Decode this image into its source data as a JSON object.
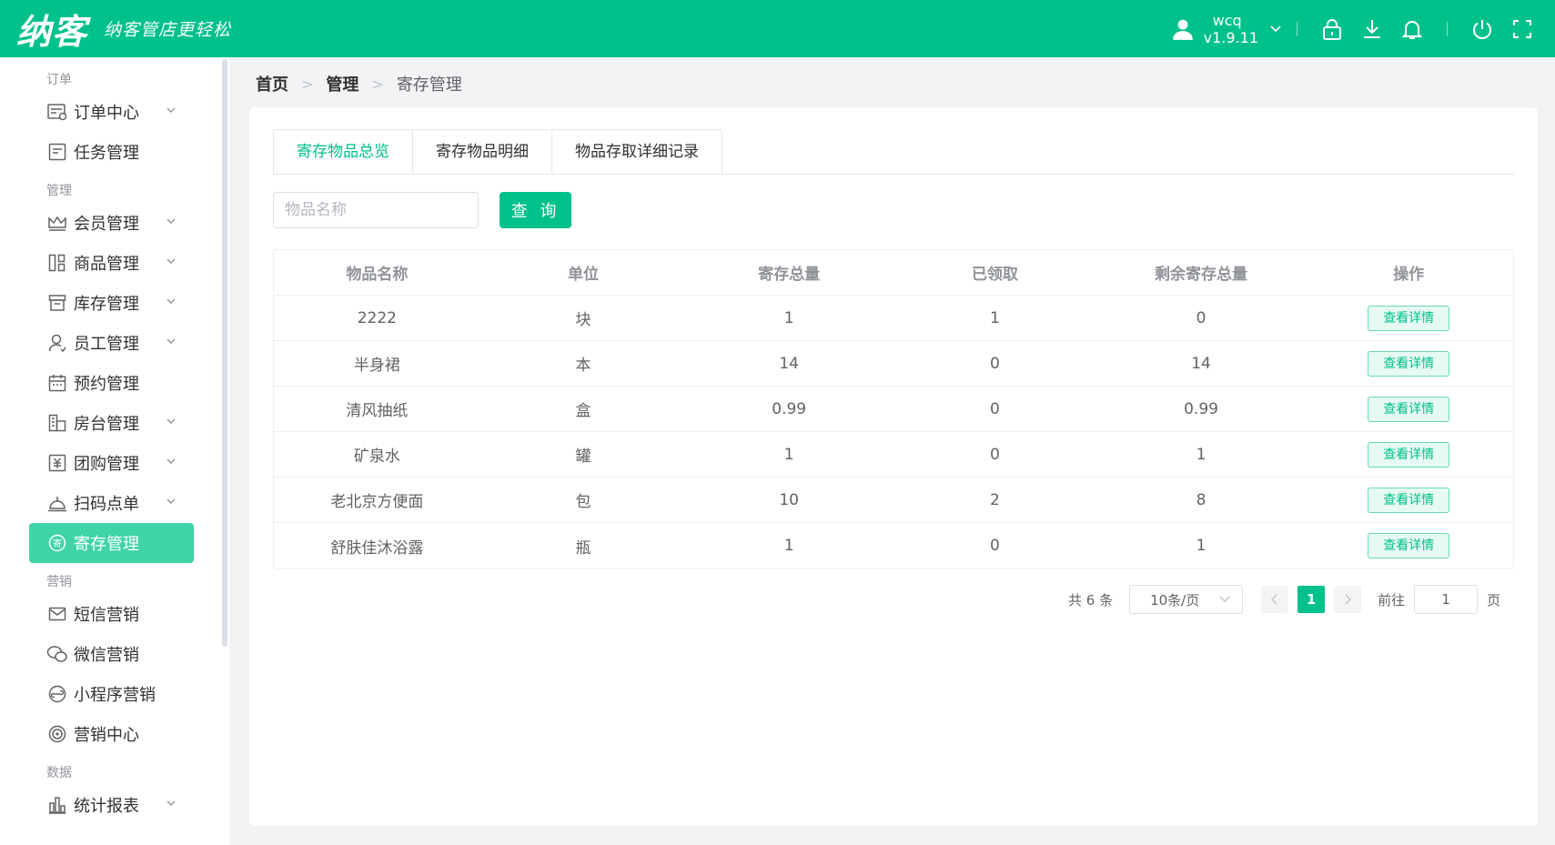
{
  "header": {
    "logo_main": "纳客",
    "slogan": "纳客管店更轻松",
    "username": "wcq",
    "version": "v1.9.11"
  },
  "sidebar": {
    "groups": [
      {
        "label": "订单",
        "items": [
          {
            "label": "订单中心",
            "icon": "order-icon",
            "has_arrow": true
          },
          {
            "label": "任务管理",
            "icon": "task-icon",
            "has_arrow": false
          }
        ]
      },
      {
        "label": "管理",
        "items": [
          {
            "label": "会员管理",
            "icon": "crown-icon",
            "has_arrow": true
          },
          {
            "label": "商品管理",
            "icon": "goods-icon",
            "has_arrow": true
          },
          {
            "label": "库存管理",
            "icon": "inventory-icon",
            "has_arrow": true
          },
          {
            "label": "员工管理",
            "icon": "staff-icon",
            "has_arrow": true
          },
          {
            "label": "预约管理",
            "icon": "calendar-icon",
            "has_arrow": false
          },
          {
            "label": "房台管理",
            "icon": "room-icon",
            "has_arrow": true
          },
          {
            "label": "团购管理",
            "icon": "groupbuy-icon",
            "has_arrow": true
          },
          {
            "label": "扫码点单",
            "icon": "bell-service-icon",
            "has_arrow": true
          },
          {
            "label": "寄存管理",
            "icon": "deposit-icon",
            "has_arrow": false,
            "active": true
          }
        ]
      },
      {
        "label": "营销",
        "items": [
          {
            "label": "短信营销",
            "icon": "mail-icon",
            "has_arrow": false
          },
          {
            "label": "微信营销",
            "icon": "wechat-icon",
            "has_arrow": false
          },
          {
            "label": "小程序营销",
            "icon": "miniprogram-icon",
            "has_arrow": false
          },
          {
            "label": "营销中心",
            "icon": "target-icon",
            "has_arrow": false
          }
        ]
      },
      {
        "label": "数据",
        "items": [
          {
            "label": "统计报表",
            "icon": "chart-icon",
            "has_arrow": true
          }
        ]
      }
    ]
  },
  "breadcrumb": {
    "home": "首页",
    "section": "管理",
    "current": "寄存管理"
  },
  "tabs": [
    {
      "label": "寄存物品总览",
      "active": true
    },
    {
      "label": "寄存物品明细",
      "active": false
    },
    {
      "label": "物品存取详细记录",
      "active": false
    }
  ],
  "search": {
    "placeholder": "物品名称",
    "value": "",
    "button_label": "查 询"
  },
  "table": {
    "columns": [
      "物品名称",
      "单位",
      "寄存总量",
      "已领取",
      "剩余寄存总量",
      "操作"
    ],
    "rows": [
      {
        "name": "2222",
        "unit": "块",
        "total": "1",
        "taken": "1",
        "remaining": "0",
        "action": "查看详情"
      },
      {
        "name": "半身裙",
        "unit": "本",
        "total": "14",
        "taken": "0",
        "remaining": "14",
        "action": "查看详情"
      },
      {
        "name": "清风抽纸",
        "unit": "盒",
        "total": "0.99",
        "taken": "0",
        "remaining": "0.99",
        "action": "查看详情"
      },
      {
        "name": "矿泉水",
        "unit": "罐",
        "total": "1",
        "taken": "0",
        "remaining": "1",
        "action": "查看详情"
      },
      {
        "name": "老北京方便面",
        "unit": "包",
        "total": "10",
        "taken": "2",
        "remaining": "8",
        "action": "查看详情"
      },
      {
        "name": "舒肤佳沐浴露",
        "unit": "瓶",
        "total": "1",
        "taken": "0",
        "remaining": "1",
        "action": "查看详情"
      }
    ]
  },
  "pagination": {
    "total_text": "共 6 条",
    "page_size": "10条/页",
    "current_page": "1",
    "goto_label": "前往",
    "goto_value": "1",
    "page_suffix": "页"
  },
  "colors": {
    "brand": "#00c08b",
    "active_menu": "#3fd4a7",
    "logo_accent": "#ffe66b"
  }
}
